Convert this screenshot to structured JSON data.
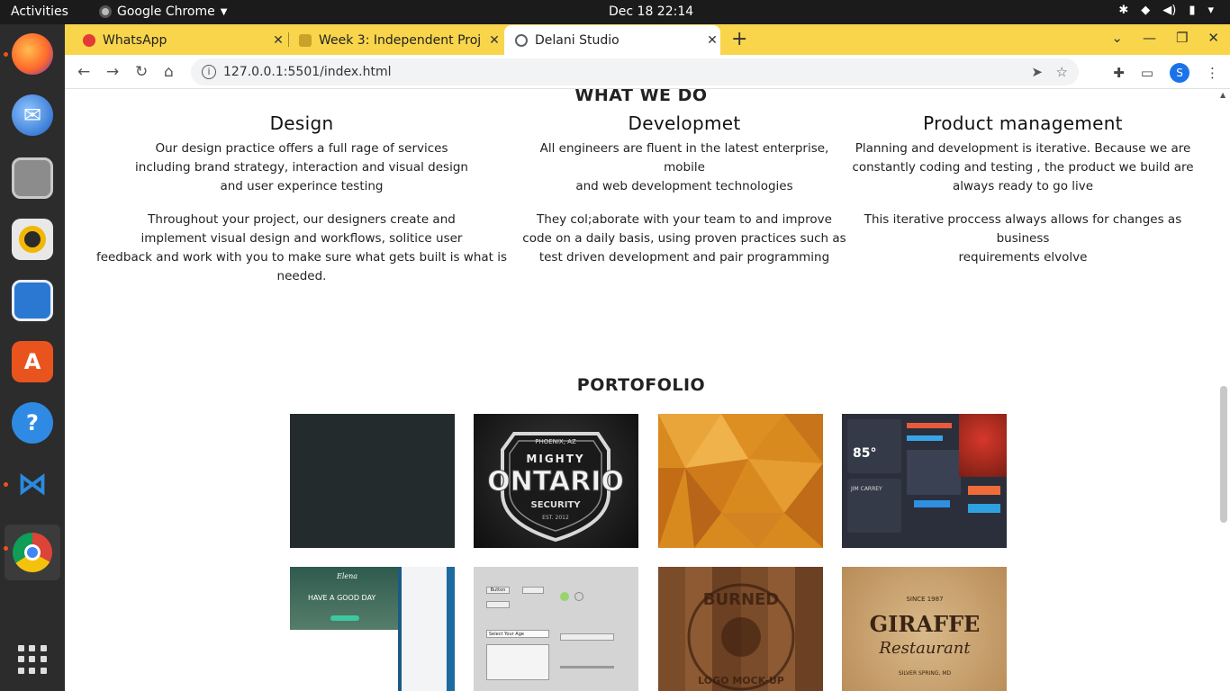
{
  "os": {
    "activities": "Activities",
    "app_name": "Google Chrome",
    "clock": "Dec 18  22:14"
  },
  "browser": {
    "tabs": [
      {
        "label": "WhatsApp",
        "favicon_color": "#e53935"
      },
      {
        "label": "Week 3: Independent Proj",
        "favicon_color": "#c9a227"
      },
      {
        "label": "Delani Studio",
        "favicon_color": "#5f6368"
      }
    ],
    "url": "127.0.0.1:5501/index.html",
    "profile_initial": "S"
  },
  "page": {
    "what_we_do": {
      "heading": "WHAT WE DO",
      "columns": [
        {
          "title": "Design",
          "paragraphs": [
            [
              "Our design practice offers a full rage of services",
              "including brand strategy, interaction and visual design",
              "and user experince testing"
            ],
            [
              "Throughout your project, our designers create and",
              "implement visual design and workflows, solitice user",
              "feedback and work with you to make sure what gets built is what is needed."
            ]
          ]
        },
        {
          "title": "Developmet",
          "paragraphs": [
            [
              "All engineers are fluent in the latest enterprise, mobile",
              "and web development technologies"
            ],
            [
              "They col;aborate with your team to and improve",
              "code on a daily basis, using proven practices such as",
              "test driven development and pair programming"
            ]
          ]
        },
        {
          "title": "Product management",
          "paragraphs": [
            [
              "Planning and development is iterative. Because we are",
              "constantly coding and testing , the product we build are",
              "always ready to go live"
            ],
            [
              "This iterative proccess always allows for changes as business",
              "requirements elvolve"
            ]
          ]
        }
      ]
    },
    "portfolio": {
      "heading": "PORTOFOLIO",
      "tiles": [
        {
          "name": "dark-slate",
          "text": ""
        },
        {
          "name": "mighty-ontario-logo",
          "top": "PHOENIX, AZ",
          "line1": "MIGHTY",
          "line2": "ONTARIO",
          "line3": "SECURITY",
          "line4": "EST. 2012"
        },
        {
          "name": "orange-polygon",
          "text": ""
        },
        {
          "name": "weather-ui-kit",
          "temp": "85°",
          "person": "JIM CARREY"
        },
        {
          "name": "website-mockup",
          "brand": "Elena",
          "headline": "HAVE A GOOD DAY"
        },
        {
          "name": "ui-controls-kit",
          "button": "Button",
          "select": "Select Your Age"
        },
        {
          "name": "burned-logo",
          "line1": "BURNED",
          "line2": "LOGO MOCK-UP"
        },
        {
          "name": "giraffe-restaurant",
          "since": "SINCE 1987",
          "line1": "GIRAFFE",
          "line2": "Restaurant",
          "line3": "SILVER SPRING, MD"
        }
      ]
    }
  }
}
